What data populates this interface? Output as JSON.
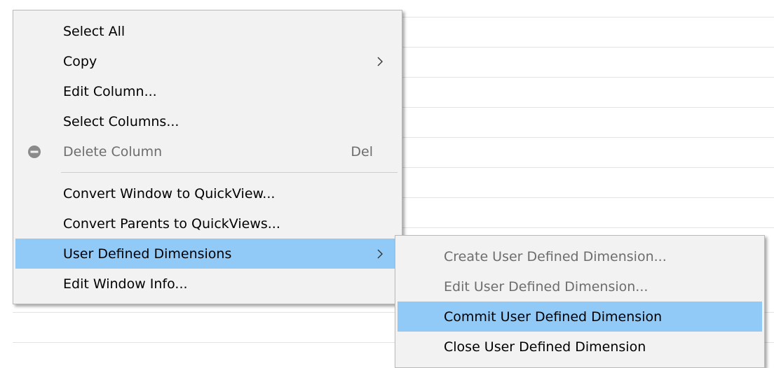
{
  "context_menu": {
    "items": [
      {
        "label": "Select All"
      },
      {
        "label": "Copy"
      },
      {
        "label": "Edit Column..."
      },
      {
        "label": "Select Columns..."
      },
      {
        "label": "Delete Column",
        "shortcut": "Del"
      },
      {
        "label": "Convert Window to QuickView..."
      },
      {
        "label": "Convert Parents to QuickViews..."
      },
      {
        "label": "User Defined Dimensions"
      },
      {
        "label": "Edit Window Info..."
      }
    ]
  },
  "submenu": {
    "items": [
      {
        "label": "Create User Defined Dimension..."
      },
      {
        "label": "Edit User Defined Dimension..."
      },
      {
        "label": "Commit User Defined Dimension"
      },
      {
        "label": "Close User Defined Dimension"
      }
    ]
  },
  "colors": {
    "highlight": "#91c9f7",
    "menu_background": "#f2f2f2",
    "disabled_text": "#6d6d6d"
  },
  "icons": {
    "submenu_arrow": "chevron-right-icon",
    "delete": "minus-circle-icon"
  }
}
